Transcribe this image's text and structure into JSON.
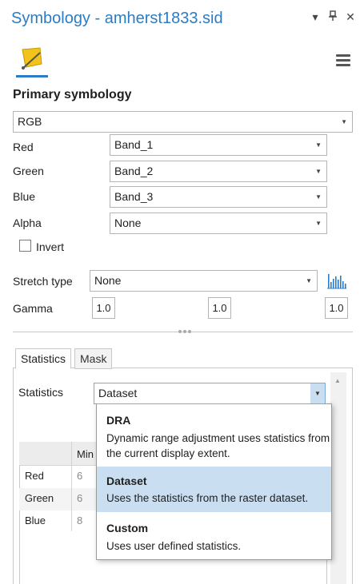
{
  "window": {
    "title": "Symbology - amherst1833.sid",
    "controls": [
      "▾",
      "✕"
    ]
  },
  "section_title": "Primary symbology",
  "renderer": {
    "value": "RGB"
  },
  "bands": [
    {
      "label": "Red",
      "value": "Band_1"
    },
    {
      "label": "Green",
      "value": "Band_2"
    },
    {
      "label": "Blue",
      "value": "Band_3"
    },
    {
      "label": "Alpha",
      "value": "None"
    }
  ],
  "invert": {
    "label": "Invert",
    "checked": false
  },
  "stretch": {
    "label": "Stretch type",
    "value": "None"
  },
  "gamma": {
    "label": "Gamma",
    "values": [
      "1.0",
      "1.0",
      "1.0"
    ]
  },
  "tabs": [
    {
      "label": "Statistics",
      "active": true
    },
    {
      "label": "Mask",
      "active": false
    }
  ],
  "statistics": {
    "label": "Statistics",
    "value": "Dataset",
    "options": [
      {
        "title": "DRA",
        "desc": "Dynamic range adjustment uses statistics from the current display extent.",
        "selected": false
      },
      {
        "title": "Dataset",
        "desc": "Uses the statistics from the raster dataset.",
        "selected": true
      },
      {
        "title": "Custom",
        "desc": "Uses user defined statistics.",
        "selected": false
      }
    ]
  },
  "grid": {
    "header_partial": "Min",
    "rows": [
      {
        "label": "Red",
        "min": "6"
      },
      {
        "label": "Green",
        "min": "6"
      },
      {
        "label": "Blue",
        "min": "8"
      }
    ]
  },
  "colors": {
    "accent": "#2b7cc4",
    "selected": "#c9dff1"
  },
  "icons": [
    "symbology-icon",
    "menu-icon",
    "pin-icon",
    "close-icon",
    "histogram-icon",
    "chevron-down-icon"
  ]
}
